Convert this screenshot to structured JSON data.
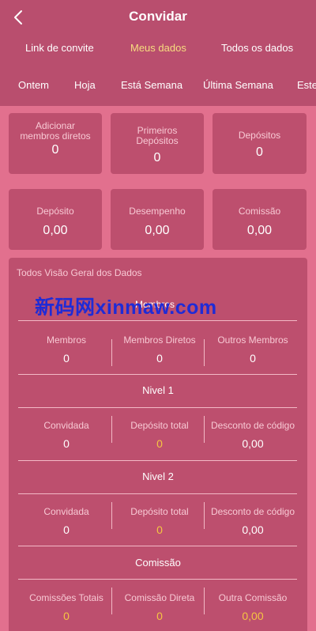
{
  "header": {
    "title": "Convidar"
  },
  "tabs": [
    {
      "label": "Link de convite",
      "active": false
    },
    {
      "label": "Meus dados",
      "active": true
    },
    {
      "label": "Todos os dados",
      "active": false
    }
  ],
  "filters": [
    "Ontem",
    "Hoja",
    "Está Semana",
    "Última Semana",
    "Este"
  ],
  "summary_top": [
    {
      "label": "Adicionar membros diretos",
      "value": "0"
    },
    {
      "label": "Primeiros Depósitos",
      "value": "0"
    },
    {
      "label": "Depósitos",
      "value": "0"
    }
  ],
  "summary_bottom": [
    {
      "label": "Depósito",
      "value": "0,00"
    },
    {
      "label": "Desempenho",
      "value": "0,00"
    },
    {
      "label": "Comissão",
      "value": "0,00"
    }
  ],
  "overview": {
    "title": "Todos Visão Geral dos Dados",
    "watermark": "新码网xinmaw.com",
    "overlay_text": "Membros",
    "members": [
      {
        "label": "Membros",
        "value": "0"
      },
      {
        "label": "Membros Diretos",
        "value": "0"
      },
      {
        "label": "Outros Membros",
        "value": "0"
      }
    ],
    "level1": {
      "title": "Nivel 1",
      "items": [
        {
          "label": "Convidada",
          "value": "0"
        },
        {
          "label": "Depósito total",
          "value": "0"
        },
        {
          "label": "Desconto de código",
          "value": "0,00"
        }
      ]
    },
    "level2": {
      "title": "Nivel 2",
      "items": [
        {
          "label": "Convidada",
          "value": "0"
        },
        {
          "label": "Depósito total",
          "value": "0"
        },
        {
          "label": "Desconto de código",
          "value": "0,00"
        }
      ]
    },
    "commission": {
      "title": "Comissão",
      "items": [
        {
          "label": "Comissões Totais",
          "value": "0"
        },
        {
          "label": "Comissão Direta",
          "value": "0"
        },
        {
          "label": "Outra Comissão",
          "value": "0,00"
        }
      ]
    }
  },
  "colors": {
    "accent": "#f7dd7f",
    "gold": "#f5c542",
    "background": "#e2708e",
    "panel": "#bd4f6e"
  }
}
